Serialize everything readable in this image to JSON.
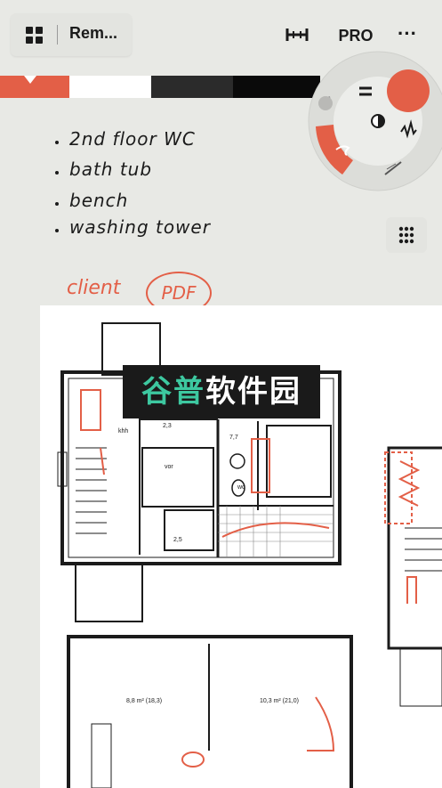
{
  "toolbar": {
    "document_title": "Rem...",
    "pro_label": "PRO",
    "more_label": "···",
    "icons": [
      "grid-menu-icon",
      "ruler-icon",
      "more-icon"
    ]
  },
  "palette": {
    "swatches": [
      "#e35f47",
      "#ffffff",
      "#2b2b2b",
      "#0a0a0a"
    ],
    "selected_index": 0,
    "tool_wheel": {
      "active_color": "#e35f47",
      "tools": [
        "brush-tool",
        "pencil-tool",
        "eraser-tool",
        "pen-tool",
        "opacity-control",
        "size-control"
      ]
    }
  },
  "notes": {
    "items": [
      "2nd floor WC",
      "bath tub",
      "bench",
      "washing tower"
    ],
    "client_label": "client",
    "pdf_label": "PDF"
  },
  "plan": {
    "labels": [
      "khh",
      "2,3",
      "7,7",
      "wc",
      "vor",
      "2,5",
      "8,8 m² (18,3)",
      "10,3 m² (21,0)"
    ]
  },
  "watermark": {
    "part_a": "谷普",
    "part_b": "软件园"
  }
}
